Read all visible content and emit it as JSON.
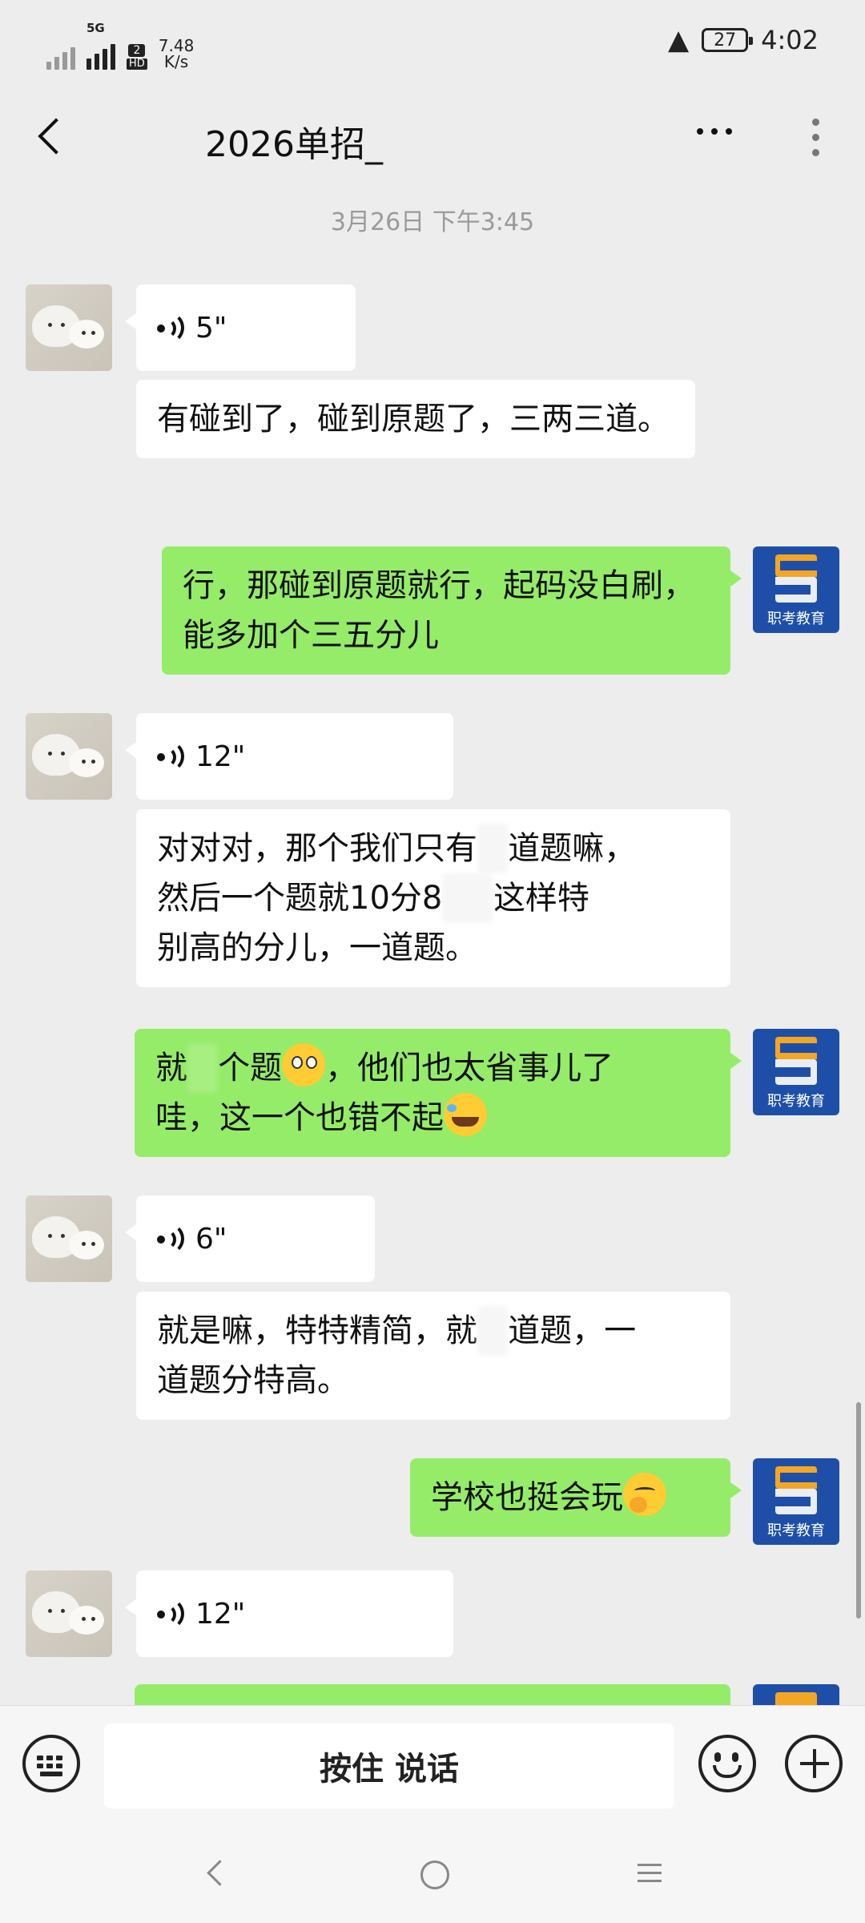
{
  "status_bar": {
    "network_type": "5G",
    "hd_badge_top": "2",
    "hd_badge_bottom": "HD",
    "speed_value": "7.48",
    "speed_unit": "K/s",
    "battery": "27",
    "time": "4:02"
  },
  "header": {
    "title": "2026单招_"
  },
  "timestamp": "3月26日 下午3:45",
  "messages": [
    {
      "sender": "other",
      "type": "voice",
      "duration": "5\""
    },
    {
      "sender": "other",
      "type": "text",
      "text": "有碰到了，碰到原题了，三两三道。"
    },
    {
      "sender": "me",
      "type": "text",
      "text": "行，那碰到原题就行，起码没白刷，能多加个三五分儿"
    },
    {
      "sender": "other",
      "type": "voice",
      "duration": "12\""
    },
    {
      "sender": "other",
      "type": "text",
      "line1_a": "对对对，那个我们只有",
      "line1_b": "道题嘛，",
      "line2_a": "然后一个题就10分8",
      "line2_b": "这样特",
      "line3": "别高的分儿，一道题。"
    },
    {
      "sender": "me",
      "type": "text",
      "part1": "就",
      "part2": "个题",
      "part3": "，他们也太省事儿了",
      "part4": "哇，这一个也错不起"
    },
    {
      "sender": "other",
      "type": "voice",
      "duration": "6\""
    },
    {
      "sender": "other",
      "type": "text",
      "line1_a": "就是嘛，特特精简，就",
      "line1_b": "道题，一",
      "line2": "道题分特高。"
    },
    {
      "sender": "me",
      "type": "text",
      "text": "学校也挺会玩"
    },
    {
      "sender": "other",
      "type": "voice",
      "duration": "12\""
    }
  ],
  "avatars": {
    "me_label": "职考教育"
  },
  "input_bar": {
    "hold_to_talk": "按住 说话"
  },
  "icons": {
    "back": "back-arrow-icon",
    "more": "more-icon",
    "keyboard": "keyboard-icon",
    "emoji": "emoji-icon",
    "plus": "plus-icon"
  }
}
